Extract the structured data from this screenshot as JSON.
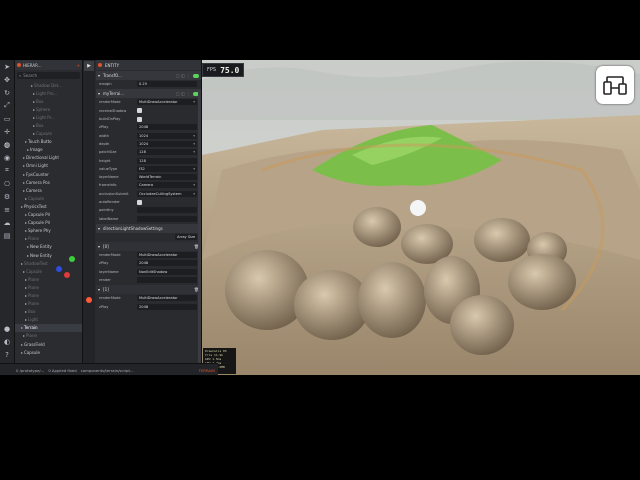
{
  "toolbar": {
    "icons": [
      "cursor-icon",
      "move-icon",
      "rotate-icon",
      "scale-icon",
      "rect-icon",
      "transform-icon",
      "globe-icon",
      "eye-icon",
      "snap-icon",
      "camera-icon",
      "settings-icon",
      "layers-icon",
      "cloud-icon",
      "terminal-icon",
      "github-icon",
      "discord-icon",
      "help-icon",
      "keyboard-icon",
      "gear-icon"
    ]
  },
  "hierarchy": {
    "title": "HIERAR...",
    "search_placeholder": "Search",
    "items": [
      {
        "label": "Shadow Det...",
        "dim": true
      },
      {
        "label": "Light Pro...",
        "dim": true
      },
      {
        "label": "Box",
        "dim": true
      },
      {
        "label": "Sphere",
        "dim": true
      },
      {
        "label": "Light Pr...",
        "dim": true
      },
      {
        "label": "Box",
        "dim": true
      },
      {
        "label": "Capsule",
        "dim": true
      },
      {
        "label": "Touch Butto",
        "dim": false
      },
      {
        "label": "Image",
        "dim": false
      },
      {
        "label": "Directional Light",
        "dim": false
      },
      {
        "label": "Omni Light",
        "dim": false
      },
      {
        "label": "FpsCounter",
        "dim": false
      },
      {
        "label": "Camera Pos",
        "dim": false
      },
      {
        "label": "Camera",
        "dim": false
      },
      {
        "label": "Capsule",
        "dim": true
      },
      {
        "label": "PhysicsTest",
        "dim": false
      },
      {
        "label": "Capsule Pri",
        "dim": false
      },
      {
        "label": "Capsule Pri",
        "dim": false
      },
      {
        "label": "Sphere Phy",
        "dim": false
      },
      {
        "label": "Plane",
        "dim": true
      },
      {
        "label": "New Entity",
        "dim": false
      },
      {
        "label": "New Entity",
        "dim": false
      },
      {
        "label": "ShadowTest",
        "dim": true
      },
      {
        "label": "Capsule",
        "dim": true
      },
      {
        "label": "Plane",
        "dim": true
      },
      {
        "label": "Plane",
        "dim": true
      },
      {
        "label": "Plane",
        "dim": true
      },
      {
        "label": "Plane",
        "dim": true
      },
      {
        "label": "Box",
        "dim": true
      },
      {
        "label": "Light",
        "dim": true
      },
      {
        "label": "Terrain",
        "dim": false,
        "selected": true
      },
      {
        "label": "Plane",
        "dim": true
      },
      {
        "label": "GrassField",
        "dim": false
      },
      {
        "label": "Capsule",
        "dim": false
      }
    ]
  },
  "inspector": {
    "title": "ENTITY",
    "component_label": "TransfO...",
    "transform_rows": [
      {
        "key": "margin",
        "value": "0.25"
      }
    ],
    "terrain_label": "myTerrai...",
    "props": [
      {
        "key": "renderMode",
        "value": "MultiDrawAccelerator",
        "type": "dd"
      },
      {
        "key": "receiveShadow",
        "type": "chk"
      },
      {
        "key": "buildOnPlay",
        "type": "chk"
      },
      {
        "key": "zPlay",
        "value": "2048",
        "type": "txt"
      },
      {
        "key": "width",
        "value": "1024",
        "type": "dd"
      },
      {
        "key": "depth",
        "value": "1024",
        "type": "dd"
      },
      {
        "key": "patchSize",
        "value": "128",
        "type": "dd"
      },
      {
        "key": "height",
        "value": "128",
        "type": "txt"
      },
      {
        "key": "valueType",
        "value": "f32",
        "type": "dd"
      },
      {
        "key": "layerName",
        "value": "WorldTerrain",
        "type": "txt"
      },
      {
        "key": "frameInfo",
        "value": "Camera",
        "type": "dd"
      },
      {
        "key": "occlusionSubmit",
        "value": "OccludeeCullingSystem",
        "type": "dd"
      },
      {
        "key": "autoRender",
        "type": "chk"
      },
      {
        "key": "pointIny",
        "type": "txt",
        "value": ""
      },
      {
        "key": "labelName",
        "type": "txt",
        "value": ""
      }
    ],
    "shadow_label": "directionLightShadowSettings",
    "array_size": "Array Size",
    "shadow_items": [
      {
        "index": "[0]",
        "props": [
          {
            "key": "renderMode",
            "value": "MultiDrawAccelerator"
          },
          {
            "key": "zPlay",
            "value": "2048"
          },
          {
            "key": "layerName",
            "value": "NonEditShadow"
          },
          {
            "key": "render",
            "value": ""
          }
        ]
      },
      {
        "index": "[1]",
        "props": [
          {
            "key": "renderMode",
            "value": "MultiDrawAccelerator"
          },
          {
            "key": "zPlay",
            "value": "2048"
          }
        ]
      }
    ]
  },
  "status": {
    "items": [
      "0 /prototype/...",
      "0 Applied fixed",
      "components/terrain/script...",
      "TERRAIN"
    ]
  },
  "fps": {
    "label": "FPS",
    "value": "75.0"
  },
  "stats": [
    "DrawCalls 85",
    "Tris 11.9k",
    "GPU 1.5ms",
    "CPU 2.4ms",
    "Mem 146.0MB"
  ],
  "device_button": {
    "icon": "responsive-devices-icon"
  }
}
